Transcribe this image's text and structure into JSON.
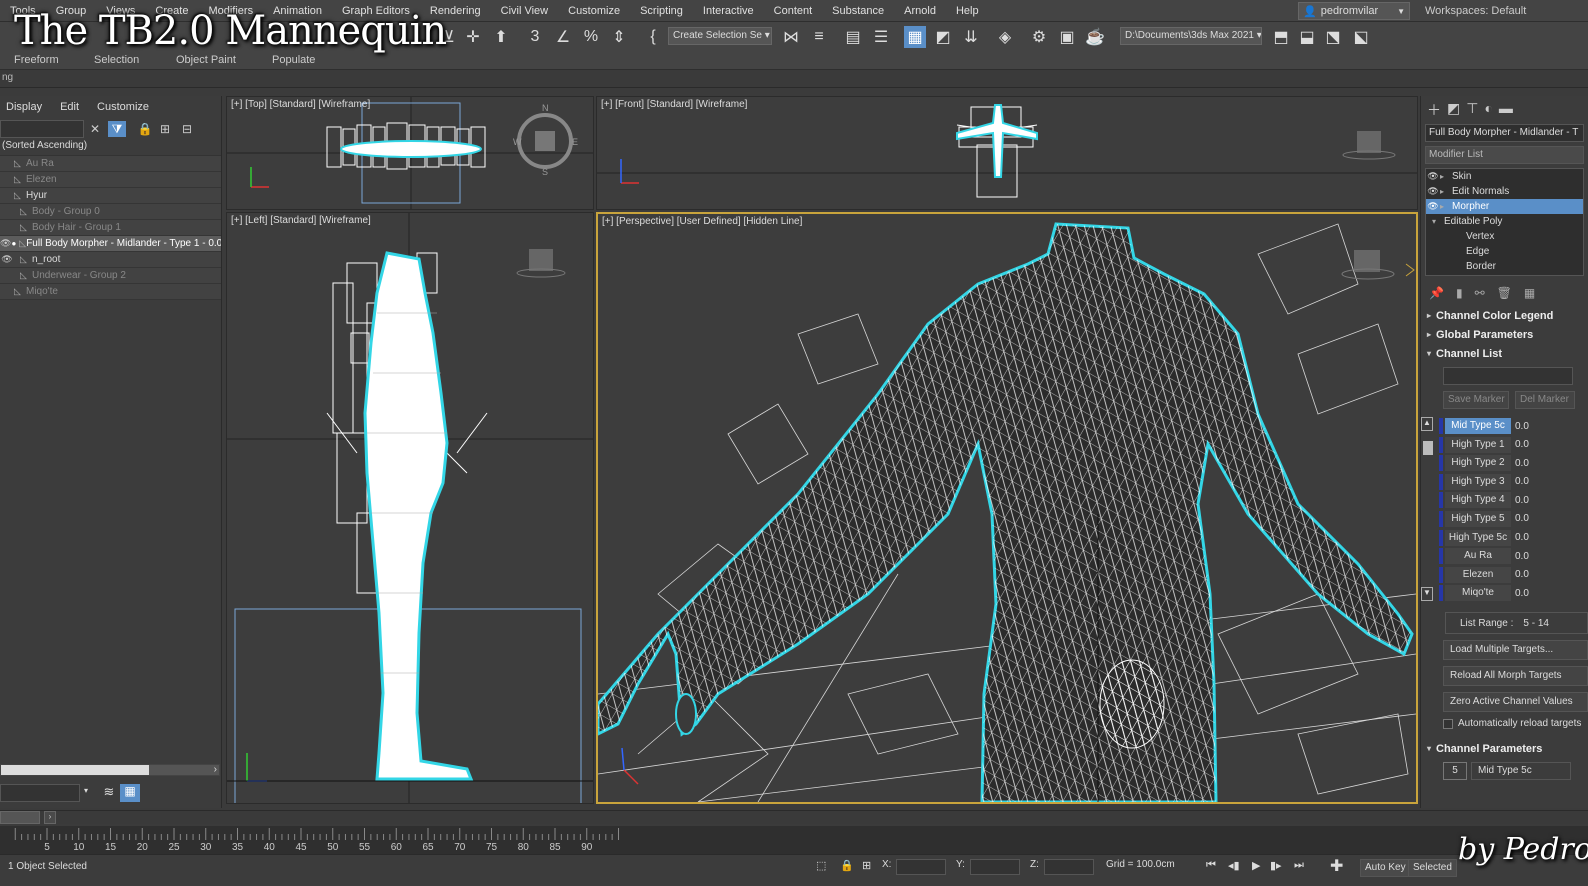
{
  "overlay": {
    "title": "The TB2.0 Mannequin",
    "byline": "by Pedro"
  },
  "menubar": {
    "items": [
      "Tools",
      "Group",
      "Views",
      "Create",
      "Modifiers",
      "Animation",
      "Graph Editors",
      "Rendering",
      "Civil View",
      "Customize",
      "Scripting",
      "Interactive",
      "Content",
      "Substance",
      "Arnold",
      "Help"
    ],
    "user": "pedromvilar",
    "workspace_label": "Workspaces: Default"
  },
  "toolbar": {
    "selection_set": "Create Selection Se",
    "project_path": "D:\\Documents\\3ds Max 2021",
    "ribbon_tabs": [
      "Freeform",
      "Selection",
      "Object Paint",
      "Populate"
    ]
  },
  "subbar": {
    "text": "ng"
  },
  "explorer": {
    "menu": [
      "Display",
      "Edit",
      "Customize"
    ],
    "sort_header": "(Sorted Ascending)",
    "rows": [
      {
        "label": "Au Ra",
        "state": "dim"
      },
      {
        "label": "Elezen",
        "state": "dim"
      },
      {
        "label": "Hyur",
        "state": "normal"
      },
      {
        "label": "Body - Group 0",
        "state": "dim"
      },
      {
        "label": "Body Hair - Group 1",
        "state": "dim"
      },
      {
        "label": "Full Body Morpher - Midlander - Type 1 - 0.0",
        "state": "selected"
      },
      {
        "label": "n_root",
        "state": "normal"
      },
      {
        "label": "Underwear - Group 2",
        "state": "dim"
      },
      {
        "label": "Miqo'te",
        "state": "dim"
      }
    ]
  },
  "viewports": {
    "top": "[+] [Top] [Standard] [Wireframe]",
    "front": "[+] [Front] [Standard] [Wireframe]",
    "left": "[+] [Left] [Standard] [Wireframe]",
    "perspective": "[+] [Perspective] [User Defined] [Hidden Line]"
  },
  "command_panel": {
    "object_name": "Full Body Morpher - Midlander - T",
    "modifier_list": "Modifier List",
    "stack": [
      {
        "label": "Skin",
        "type": "modifier",
        "selected": false
      },
      {
        "label": "Edit Normals",
        "type": "modifier",
        "selected": false
      },
      {
        "label": "Morpher",
        "type": "modifier",
        "selected": true
      },
      {
        "label": "Editable Poly",
        "type": "base",
        "selected": false
      },
      {
        "label": "Vertex",
        "type": "sub",
        "selected": false
      },
      {
        "label": "Edge",
        "type": "sub",
        "selected": false
      },
      {
        "label": "Border",
        "type": "sub",
        "selected": false
      }
    ],
    "rollouts": {
      "color_legend": "Channel Color Legend",
      "global_params": "Global Parameters",
      "channel_list": "Channel List",
      "channel_params": "Channel Parameters"
    },
    "marker_buttons": {
      "save": "Save Marker",
      "delete": "Del Marker"
    },
    "channels": [
      {
        "name": "Mid Type 5c",
        "value": "0.0",
        "active": true
      },
      {
        "name": "High Type 1",
        "value": "0.0",
        "active": false
      },
      {
        "name": "High Type 2",
        "value": "0.0",
        "active": false
      },
      {
        "name": "High Type 3",
        "value": "0.0",
        "active": false
      },
      {
        "name": "High Type 4",
        "value": "0.0",
        "active": false
      },
      {
        "name": "High Type 5",
        "value": "0.0",
        "active": false
      },
      {
        "name": "High Type 5c",
        "value": "0.0",
        "active": false
      },
      {
        "name": "Au Ra",
        "value": "0.0",
        "active": false
      },
      {
        "name": "Elezen",
        "value": "0.0",
        "active": false
      },
      {
        "name": "Miqo'te",
        "value": "0.0",
        "active": false
      }
    ],
    "list_range_label": "List Range :",
    "list_range_value": "5 - 14",
    "buttons": {
      "load_multiple": "Load Multiple Targets...",
      "reload_all": "Reload All Morph Targets",
      "zero_active": "Zero Active Channel Values"
    },
    "auto_reload": "Automatically reload targets",
    "channel_number": "5",
    "channel_name": "Mid Type 5c"
  },
  "timeline": {
    "ticks": [
      "5",
      "10",
      "15",
      "20",
      "25",
      "30",
      "35",
      "40",
      "45",
      "50",
      "55",
      "60",
      "65",
      "70",
      "75",
      "80",
      "85",
      "90"
    ]
  },
  "status": {
    "selection": "1 Object Selected",
    "x_label": "X:",
    "y_label": "Y:",
    "z_label": "Z:",
    "grid": "Grid = 100.0cm",
    "auto_key": "Auto Key",
    "selected": "Selected"
  },
  "colors": {
    "accent": "#5a8fc8",
    "outline": "#33d6e6",
    "active_border": "#c9a43c",
    "channel_color": "#2636a8"
  }
}
